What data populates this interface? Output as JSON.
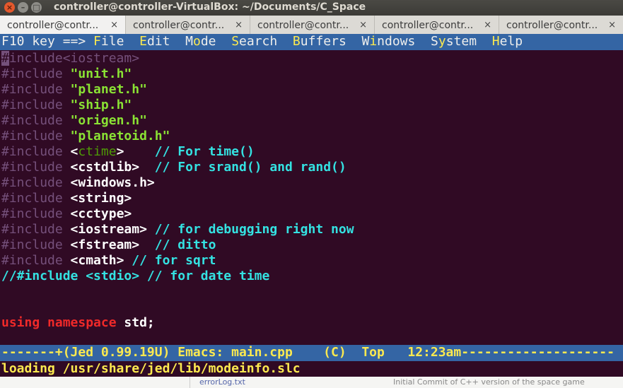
{
  "window": {
    "title": "controller@controller-VirtualBox: ~/Documents/C_Space"
  },
  "tabs": [
    {
      "label": "controller@contr...",
      "close": "×"
    },
    {
      "label": "controller@contr...",
      "close": "×"
    },
    {
      "label": "controller@contr...",
      "close": "×"
    },
    {
      "label": "controller@contr...",
      "close": "×"
    },
    {
      "label": "controller@contr...",
      "close": "×"
    }
  ],
  "menubar": {
    "prefix": "F10 key ==> ",
    "items": [
      {
        "hot": "F",
        "rest": "ile"
      },
      {
        "hot": "E",
        "rest": "dit"
      },
      {
        "pre": "M",
        "hot": "o",
        "rest": "de"
      },
      {
        "hot": "S",
        "rest": "earch"
      },
      {
        "hot": "B",
        "rest": "uffers"
      },
      {
        "pre": "W",
        "hot": "i",
        "rest": "ndows"
      },
      {
        "pre": "S",
        "hot": "y",
        "rest": "stem"
      },
      {
        "hot": "H",
        "rest": "elp"
      }
    ]
  },
  "editor": {
    "hash": "#",
    "directive": "include",
    "lines": [
      {
        "inc": "<iostream>"
      },
      {
        "inc": "\"unit.h\""
      },
      {
        "inc": "\"planet.h\""
      },
      {
        "inc": "\"ship.h\""
      },
      {
        "inc": "\"origen.h\""
      },
      {
        "inc": "\"planetoid.h\""
      },
      {
        "inc_open": "<",
        "inc_mid": "ctime",
        "inc_close": ">",
        "pad": "    ",
        "comment": "// For time()"
      },
      {
        "inc": "<cstdlib>",
        "pad": "  ",
        "comment": "// For srand() and rand()"
      },
      {
        "inc": "<windows.h>"
      },
      {
        "inc": "<string>"
      },
      {
        "inc": "<cctype>"
      },
      {
        "inc": "<iostream>",
        "pad": " ",
        "comment": "// for debugging right now"
      },
      {
        "inc": "<fstream>",
        "pad": "  ",
        "comment": "// ditto"
      },
      {
        "inc": "<cmath>",
        "pad": " ",
        "comment": "// for sqrt"
      }
    ],
    "commented_line": "//#include <stdio> // for date time",
    "using_kw": "using",
    "namespace_kw": "namespace",
    "using_rest": " std;"
  },
  "modeline": {
    "text": "-------+(Jed 0.99.19U) Emacs: main.cpp    (C)  Top   12:23am--------------------"
  },
  "minibuffer": {
    "text": "loading /usr/share/jed/lib/modeinfo.slc"
  },
  "background_window": {
    "file": "errorLog.txt",
    "message": "Initial Commit of C++ version of the space game"
  }
}
